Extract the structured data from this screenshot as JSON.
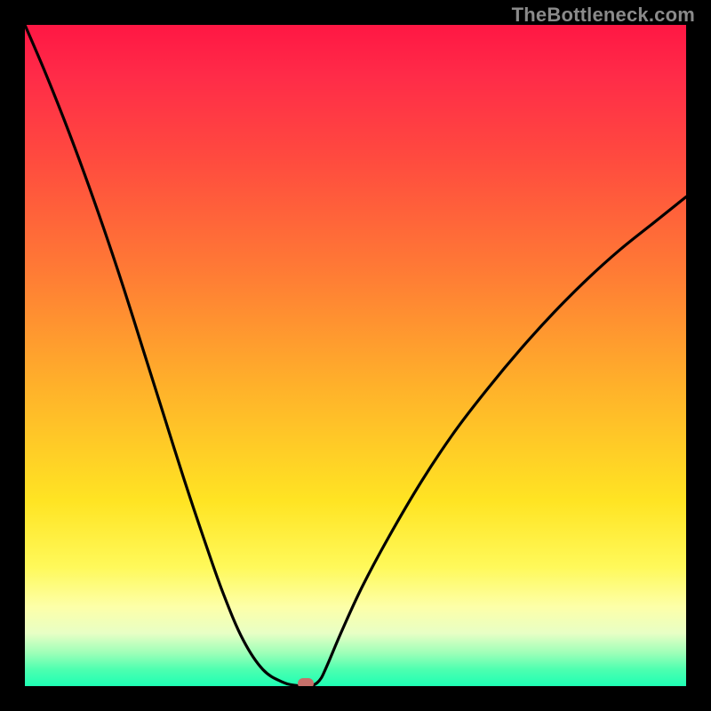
{
  "watermark": "TheBottleneck.com",
  "colors": {
    "frame": "#000000",
    "watermark": "#8a8a8a",
    "curve": "#000000",
    "marker": "#c6706a",
    "gradient_top": "#ff1744",
    "gradient_bottom": "#1effb4"
  },
  "chart_data": {
    "type": "line",
    "title": "",
    "xlabel": "",
    "ylabel": "",
    "xlim": [
      0,
      100
    ],
    "ylim": [
      0,
      100
    ],
    "x": [
      0,
      3,
      6,
      9,
      12,
      15,
      18,
      21,
      24,
      27,
      30,
      33,
      36,
      39,
      41,
      42.5,
      43.5,
      44.2,
      44.8,
      45.3,
      46,
      48,
      51,
      55,
      60,
      65,
      70,
      75,
      80,
      85,
      90,
      95,
      100
    ],
    "values": [
      100,
      93,
      85.5,
      77.5,
      69,
      60,
      50.5,
      41,
      31.5,
      22.5,
      14,
      7,
      2.5,
      0.6,
      0.1,
      0,
      0.1,
      0.5,
      1.2,
      2.2,
      3.8,
      8.5,
      15,
      22.5,
      31,
      38.5,
      45,
      51,
      56.5,
      61.5,
      66,
      70,
      74
    ],
    "marker": {
      "x": 42.5,
      "y": 0
    },
    "annotations": []
  }
}
